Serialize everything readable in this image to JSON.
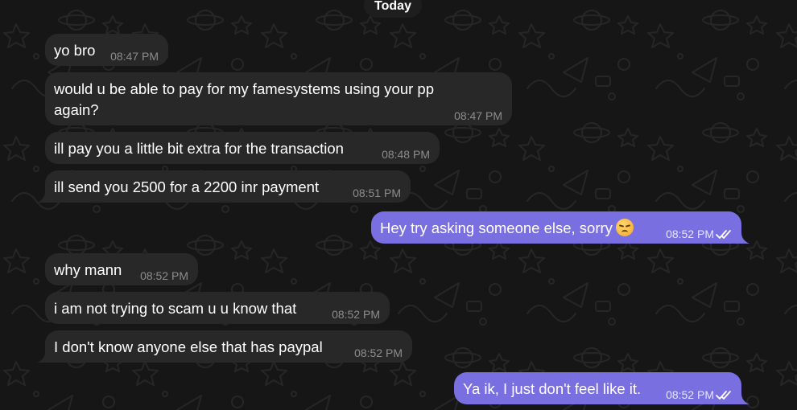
{
  "chat": {
    "date_divider": "Today",
    "messages": [
      {
        "dir": "in",
        "text": "yo bro",
        "time": "08:47 PM"
      },
      {
        "dir": "in",
        "text": "would u be able to pay for my famesystems using your pp again?",
        "time": "08:47 PM"
      },
      {
        "dir": "in",
        "text": "ill pay you a little bit extra for the transaction",
        "time": "08:48 PM"
      },
      {
        "dir": "in",
        "text": "ill send you 2500 for a 2200 inr payment",
        "time": "08:51 PM"
      },
      {
        "dir": "out",
        "text": "Hey try asking someone else, sorry",
        "emoji": "disappointed-face",
        "time": "08:52 PM",
        "read": true
      },
      {
        "dir": "in",
        "text": "why mann",
        "time": "08:52 PM"
      },
      {
        "dir": "in",
        "text": "i am not trying to scam u u know that",
        "time": "08:52 PM"
      },
      {
        "dir": "in",
        "text": "I don't know anyone else that has paypal",
        "time": "08:52 PM"
      },
      {
        "dir": "out",
        "text": "Ya ik, I just don't feel like it.",
        "time": "08:52 PM",
        "read": true
      }
    ]
  },
  "colors": {
    "background": "#161616",
    "incoming_bubble": "#282828",
    "outgoing_bubble": "#7a6fe0",
    "incoming_time": "#8d8d8d",
    "outgoing_time": "#e8e6ff"
  }
}
